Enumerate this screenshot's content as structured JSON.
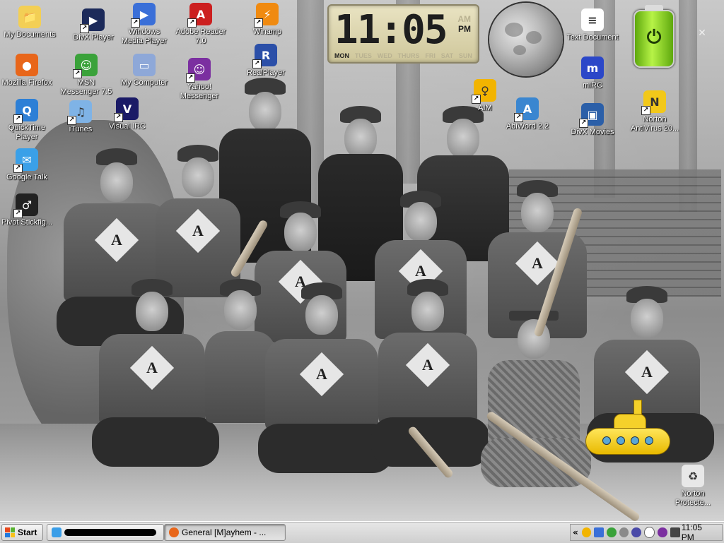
{
  "desktop": {
    "icons": [
      {
        "id": "my-documents",
        "label": "My Documents",
        "icon": "folder-documents-icon",
        "color": "#f3cf55"
      },
      {
        "id": "divx-player",
        "label": "DivX Player",
        "icon": "divx-player-icon",
        "color": "#1c2a5a",
        "shortcut": true
      },
      {
        "id": "windows-media-player",
        "label": "Windows Media Player",
        "icon": "media-player-icon",
        "color": "#3a6fd8",
        "shortcut": true
      },
      {
        "id": "adobe-reader",
        "label": "Adobe Reader 7.0",
        "icon": "pdf-reader-icon",
        "color": "#cc1f1f",
        "shortcut": true
      },
      {
        "id": "winamp",
        "label": "Winamp",
        "icon": "winamp-icon",
        "color": "#f08a10",
        "shortcut": true
      },
      {
        "id": "mozilla-firefox",
        "label": "Mozilla Firefox",
        "icon": "firefox-icon",
        "color": "#e8661a"
      },
      {
        "id": "msn-messenger",
        "label": "MSN Messenger 7.5",
        "icon": "msn-buddy-icon",
        "color": "#3aa23a",
        "shortcut": true
      },
      {
        "id": "my-computer",
        "label": "My Computer",
        "icon": "computer-icon",
        "color": "#8ea8d8"
      },
      {
        "id": "yahoo-messenger",
        "label": "Yahoo! Messenger",
        "icon": "yahoo-smiley-icon",
        "color": "#7b2fa0",
        "shortcut": true
      },
      {
        "id": "realplayer",
        "label": "RealPlayer",
        "icon": "realplayer-icon",
        "color": "#2b4fa8",
        "shortcut": true
      },
      {
        "id": "quicktime",
        "label": "QuickTime Player",
        "icon": "quicktime-icon",
        "color": "#2c7fd6",
        "shortcut": true
      },
      {
        "id": "itunes",
        "label": "iTunes",
        "icon": "music-note-icon",
        "color": "#7fb3e6",
        "shortcut": true
      },
      {
        "id": "visual-irc",
        "label": "Visual IRC",
        "icon": "visual-irc-icon",
        "color": "#1a1a66",
        "shortcut": true
      },
      {
        "id": "aim",
        "label": "AIM",
        "icon": "aim-running-man-icon",
        "color": "#f2b400",
        "shortcut": true
      },
      {
        "id": "abiword",
        "label": "AbiWord 2.2",
        "icon": "abiword-icon",
        "color": "#3a86d0",
        "shortcut": true
      },
      {
        "id": "text-document",
        "label": "Text Document",
        "icon": "text-document-icon",
        "color": "#ffffff"
      },
      {
        "id": "mirc",
        "label": "mIRC",
        "icon": "mirc-icon",
        "color": "#2b47c8"
      },
      {
        "id": "divx-movies",
        "label": "DivX Movies",
        "icon": "divx-movies-icon",
        "color": "#2b5fa8",
        "shortcut": true
      },
      {
        "id": "norton-antivirus",
        "label": "Norton AntiVirus 20...",
        "icon": "norton-antivirus-icon",
        "color": "#f2c81a",
        "shortcut": true
      },
      {
        "id": "google-talk",
        "label": "Google Talk",
        "icon": "google-talk-icon",
        "color": "#3aa0e8",
        "shortcut": true
      },
      {
        "id": "pivot-stickfigure",
        "label": "Pivot Stickfig...",
        "icon": "stickfigure-icon",
        "color": "#222222",
        "shortcut": true
      },
      {
        "id": "norton-protected-recycle-bin",
        "label": "Norton Protecte...",
        "icon": "recycle-bin-icon",
        "color": "#e8e8e8"
      }
    ]
  },
  "clock": {
    "time": "11:05",
    "ampm_active": "PM",
    "ampm_inactive": "AM",
    "days": [
      "MON",
      "TUES",
      "WED",
      "THURS",
      "FRI",
      "SAT",
      "SUN"
    ],
    "active_day": "MON"
  },
  "wallpaper": {
    "jersey_letter": "A"
  },
  "taskbar": {
    "start_label": "Start",
    "buttons": [
      {
        "label": "",
        "icon": "chat-icon",
        "redacted": true
      },
      {
        "label": "General [M]ayhem - ...",
        "icon": "firefox-icon",
        "pressed": true
      }
    ],
    "tray": {
      "chevron": "«",
      "icons": [
        "aim-tray-icon",
        "network-tray-icon",
        "msn-tray-icon",
        "volume-tray-icon",
        "irc-tray-icon",
        "chat-bubble-tray-icon",
        "yahoo-tray-icon",
        "monitor-tray-icon"
      ],
      "time": "11:05 PM"
    }
  }
}
